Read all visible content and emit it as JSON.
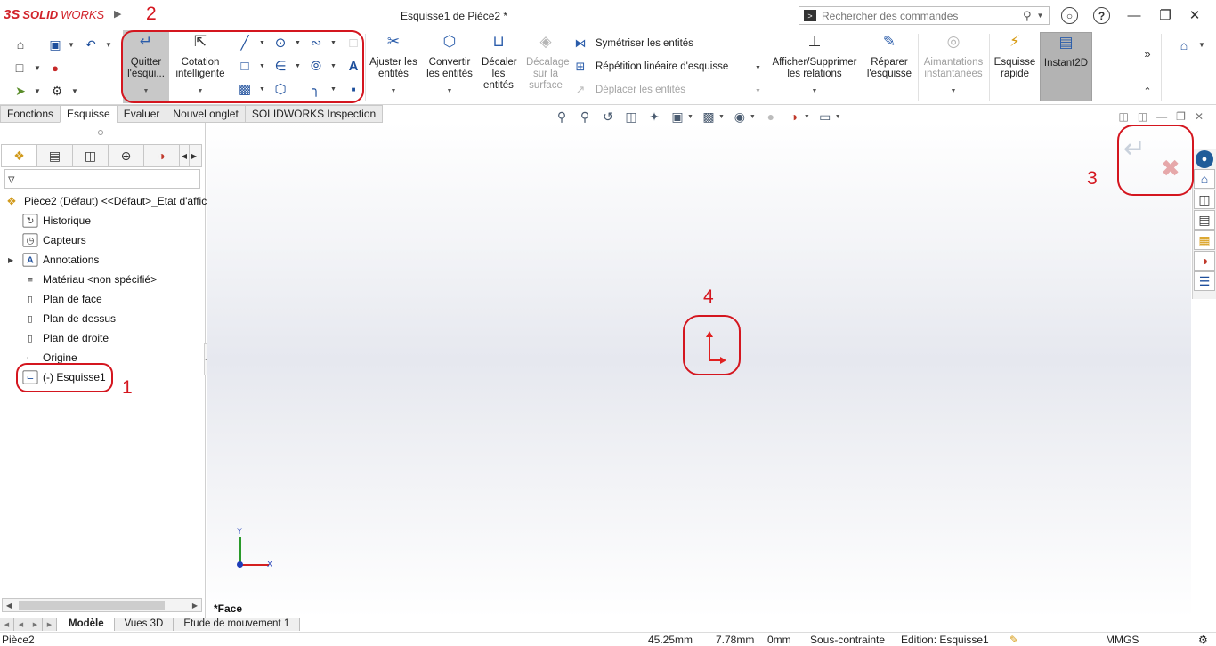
{
  "titlebar": {
    "brand_prefix": "3S",
    "brand_bold": "SOLID",
    "brand_rest": "WORKS",
    "document_title": "Esquisse1 de Pièce2 *",
    "search_placeholder": "Rechercher des commandes"
  },
  "ribbon": {
    "quit_sketch": "Quitter l'esqui...",
    "smart_dimension": "Cotation intelligente",
    "trim": "Ajuster les entités",
    "convert": "Convertir les entités",
    "offset": "Décaler les entités",
    "offset_surface": "Décalage sur la surface",
    "mirror": "Symétriser les entités",
    "linear_pattern": "Répétition linéaire d'esquisse",
    "move": "Déplacer les entités",
    "relations": "Afficher/Supprimer les relations",
    "repair": "Réparer l'esquisse",
    "snaps": "Aimantations instantanées",
    "quick_sketch": "Esquisse rapide",
    "instant2d": "Instant2D"
  },
  "tabs": [
    "Fonctions",
    "Esquisse",
    "Evaluer",
    "Nouvel onglet",
    "SOLIDWORKS Inspection"
  ],
  "tree": {
    "root": "Pièce2 (Défaut) <<Défaut>_Etat d'affic",
    "items": [
      "Historique",
      "Capteurs",
      "Annotations",
      "Matériau <non spécifié>",
      "Plan de face",
      "Plan de dessus",
      "Plan de droite",
      "Origine",
      "(-) Esquisse1"
    ]
  },
  "graphics": {
    "view_label": "*Face",
    "triad_x": "X",
    "triad_y": "Y"
  },
  "annotations": [
    "1",
    "2",
    "3",
    "4"
  ],
  "bottom_tabs": [
    "Modèle",
    "Vues 3D",
    "Etude de mouvement 1"
  ],
  "status": {
    "part": "Pièce2",
    "x": "45.25mm",
    "y": "7.78mm",
    "z": "0mm",
    "constraint": "Sous-contrainte",
    "edit": "Edition: Esquisse1",
    "units": "MMGS"
  },
  "colors": {
    "brand_red": "#d1232a",
    "annotation_red": "#d4161f",
    "active_button": "#b3b3b3"
  }
}
